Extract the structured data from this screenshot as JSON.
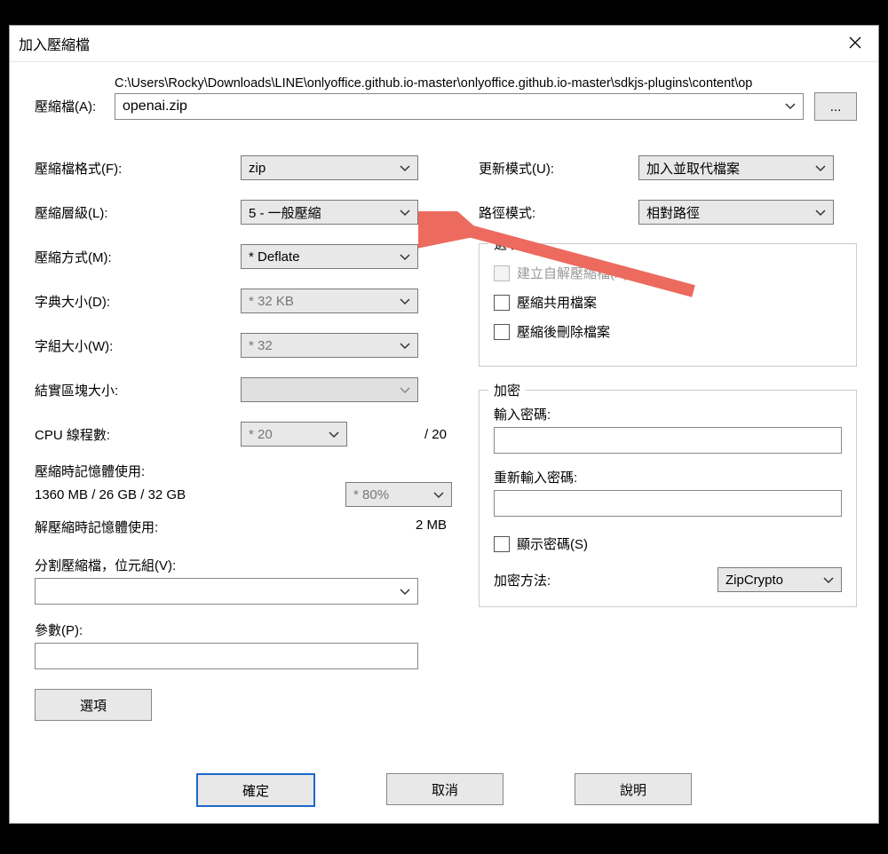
{
  "window": {
    "title": "加入壓縮檔",
    "close": "✕"
  },
  "archive": {
    "label": "壓縮檔(A):",
    "path": "C:\\Users\\Rocky\\Downloads\\LINE\\onlyoffice.github.io-master\\onlyoffice.github.io-master\\sdkjs-plugins\\content\\op",
    "filename": "openai.zip",
    "browse": "..."
  },
  "left": {
    "format_label": "壓縮檔格式(F):",
    "format_value": "zip",
    "level_label": "壓縮層級(L):",
    "level_value": "5 - 一般壓縮",
    "method_label": "壓縮方式(M):",
    "method_value": "* Deflate",
    "dict_label": "字典大小(D):",
    "dict_value": "* 32 KB",
    "word_label": "字組大小(W):",
    "word_value": "* 32",
    "block_label": "結實區塊大小:",
    "block_value": "",
    "cpu_label": "CPU 線程數:",
    "cpu_value": "* 20",
    "cpu_total": "/ 20",
    "mem_compress_label": "壓縮時記憶體使用:",
    "mem_compress_value": "1360 MB / 26 GB / 32 GB",
    "mem_percent": "* 80%",
    "mem_decompress_label": "解壓縮時記憶體使用:",
    "mem_decompress_value": "2 MB",
    "split_label": "分割壓縮檔，位元組(V):",
    "params_label": "參數(P):",
    "options_btn": "選項"
  },
  "right": {
    "update_label": "更新模式(U):",
    "update_value": "加入並取代檔案",
    "path_label": "路徑模式:",
    "path_value": "相對路徑",
    "options_group": "選項",
    "opt_sfx": "建立自解壓縮檔(X)",
    "opt_shared": "壓縮共用檔案",
    "opt_delete": "壓縮後刪除檔案",
    "encrypt_group": "加密",
    "pwd1_label": "輸入密碼:",
    "pwd2_label": "重新輸入密碼:",
    "show_pwd": "顯示密碼(S)",
    "enc_method_label": "加密方法:",
    "enc_method_value": "ZipCrypto"
  },
  "buttons": {
    "ok": "確定",
    "cancel": "取消",
    "help": "說明"
  }
}
